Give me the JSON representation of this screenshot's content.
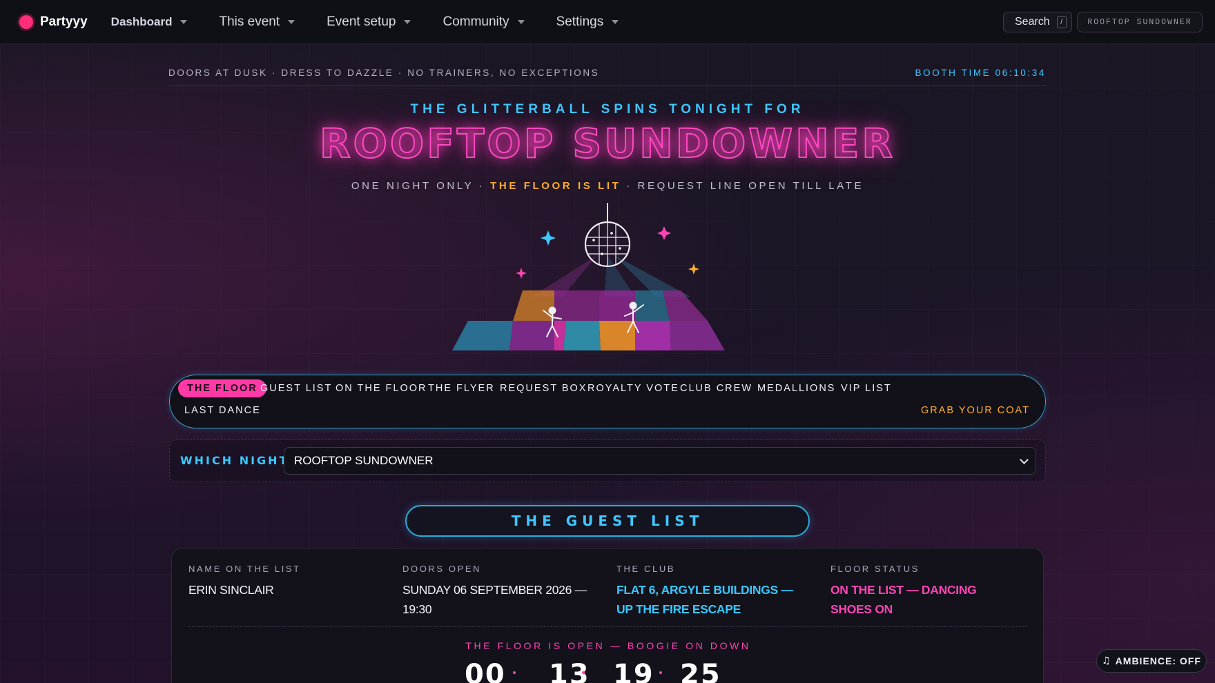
{
  "nav": {
    "brand": "Partyyy",
    "items": [
      {
        "label": "Dashboard"
      },
      {
        "label": "This event"
      },
      {
        "label": "Event setup"
      },
      {
        "label": "Community"
      },
      {
        "label": "Settings"
      }
    ],
    "search_label": "Search",
    "search_shortcut": "/",
    "event_chip": "ROOFTOP SUNDOWNER"
  },
  "header": {
    "ticker": "DOORS AT DUSK · DRESS TO DAZZLE · NO TRAINERS, NO EXCEPTIONS",
    "booth_time": "BOOTH TIME 06:10:34",
    "kicker": "THE GLITTERBALL SPINS TONIGHT FOR",
    "title": "ROOFTOP SUNDOWNER",
    "tagline_pre": "ONE NIGHT ONLY · ",
    "tagline_lit": "THE FLOOR IS LIT",
    "tagline_post": " · REQUEST LINE OPEN TILL LATE"
  },
  "tabs": {
    "items": [
      {
        "label": "THE FLOOR",
        "active": true
      },
      {
        "label": "GUEST LIST"
      },
      {
        "label": "ON THE FLOOR"
      },
      {
        "label": "THE FLYER"
      },
      {
        "label": "REQUEST BOX"
      },
      {
        "label": "ROYALTY VOTE"
      },
      {
        "label": "CLUB CREW"
      },
      {
        "label": "MEDALLIONS"
      },
      {
        "label": "VIP LIST"
      },
      {
        "label": "LAST DANCE"
      }
    ],
    "exit_label": "GRAB YOUR COAT"
  },
  "night_picker": {
    "label": "WHICH NIGHT?",
    "selected": "ROOFTOP SUNDOWNER"
  },
  "guest_list": {
    "heading": "THE GUEST LIST",
    "columns": [
      {
        "label": "NAME ON THE LIST",
        "value": "ERIN SINCLAIR"
      },
      {
        "label": "DOORS OPEN",
        "value": "SUNDAY 06 SEPTEMBER 2026 — 19:30"
      },
      {
        "label": "THE CLUB",
        "value": "FLAT 6, ARGYLE BUILDINGS — UP THE FIRE ESCAPE"
      },
      {
        "label": "FLOOR STATUS",
        "value": "ON THE LIST — DANCING SHOES ON"
      }
    ],
    "floor_open": "THE FLOOR IS OPEN — BOOGIE ON DOWN",
    "countdown": [
      "00",
      "13",
      "19",
      "25"
    ]
  },
  "ambience": {
    "icon": "music-note-icon",
    "label": "AMBIENCE: OFF"
  },
  "colors": {
    "accent_pink": "#ff3aa7",
    "accent_cyan": "#38c8ff",
    "accent_orange": "#ffae2e"
  }
}
